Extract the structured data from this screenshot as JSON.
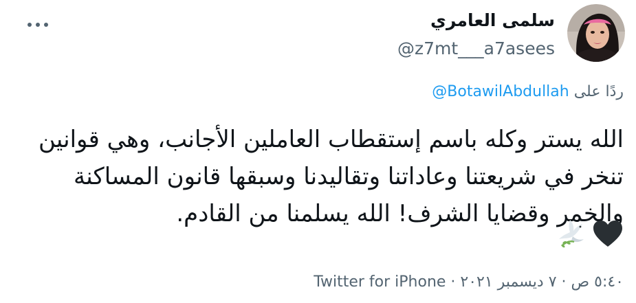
{
  "author": {
    "display_name": "سلمى العامري",
    "handle": "@z7mt___a7asees",
    "avatar_icon": "user-avatar-photo"
  },
  "more_icon": "more-horizontal-icon",
  "reply": {
    "prefix": "ردًا على ",
    "mention": "BotawilAbdullah@"
  },
  "tweet": {
    "text": "الله يستر وكله باسم إستقطاب العاملين الأجانب، وهي قوانين تنخر في شريعتنا وعاداتنا وتقاليدنا وسبقها قانون المساكنة والخمر وقضايا الشرف! الله يسلمنا من القادم.",
    "emojis": [
      "black-heart-emoji",
      "dove-emoji"
    ]
  },
  "meta": {
    "time": "٥:٤٠ ص",
    "separator1": " · ",
    "date": "٧ ديسمبر ٢٠٢١",
    "separator2": " · ",
    "source": "Twitter for iPhone"
  },
  "colors": {
    "accent": "#1d9bf0",
    "secondary_text": "#536471",
    "primary_text": "#0f1419"
  }
}
